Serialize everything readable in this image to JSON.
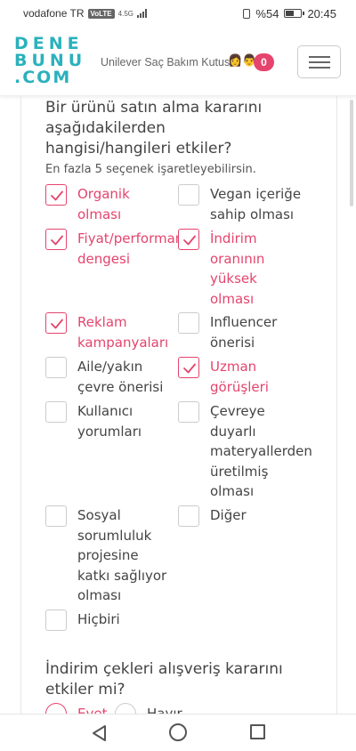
{
  "status_bar": {
    "carrier": "vodafone TR",
    "volte": "VoLTE",
    "network": "4.5G",
    "battery": "%54",
    "time": "20:45"
  },
  "header": {
    "logo_lines": [
      "DENE",
      "BUNU",
      ".COM"
    ],
    "title": "Unilever Saç Bakım Kutusu",
    "emoji": "👩👨",
    "cart_count": "0"
  },
  "question1": {
    "title": "Bir ürünü satın alma kararını aşağıdakilerden hangisi/hangileri etkiler?",
    "hint": "En fazla 5 seçenek işaretleyebilirsin.",
    "options": [
      {
        "lines": [
          "Organik",
          "olması"
        ],
        "checked": true
      },
      {
        "lines": [
          "Vegan içeriğe",
          "sahip olması"
        ],
        "checked": false
      },
      {
        "lines": [
          "Fiyat/performans",
          "dengesi"
        ],
        "checked": true
      },
      {
        "lines": [
          "İndirim",
          "oranının",
          "yüksek",
          "olması"
        ],
        "checked": true
      },
      {
        "lines": [
          "Reklam",
          "kampanyaları"
        ],
        "checked": true
      },
      {
        "lines": [
          "Influencer",
          "önerisi"
        ],
        "checked": false
      },
      {
        "lines": [
          "Aile/yakın",
          "çevre önerisi"
        ],
        "checked": false
      },
      {
        "lines": [
          "Uzman",
          "görüşleri"
        ],
        "checked": true
      },
      {
        "lines": [
          "Kullanıcı",
          "yorumları"
        ],
        "checked": false
      },
      {
        "lines": [
          "Çevreye",
          "duyarlı",
          "materyallerden",
          "üretilmiş",
          "olması"
        ],
        "checked": false
      },
      {
        "lines": [
          "Sosyal",
          "sorumluluk",
          "projesine",
          "katkı sağlıyor",
          "olması"
        ],
        "checked": false
      },
      {
        "lines": [
          "Diğer"
        ],
        "checked": false
      },
      {
        "lines": [
          "Hiçbiri"
        ],
        "checked": false
      }
    ]
  },
  "question2": {
    "title": "İndirim çekleri alışveriş kararını etkiler mi?",
    "options": [
      "Evet",
      "Hayır"
    ]
  },
  "colors": {
    "accent": "#e5446d",
    "brand": "#2bb1bd"
  }
}
